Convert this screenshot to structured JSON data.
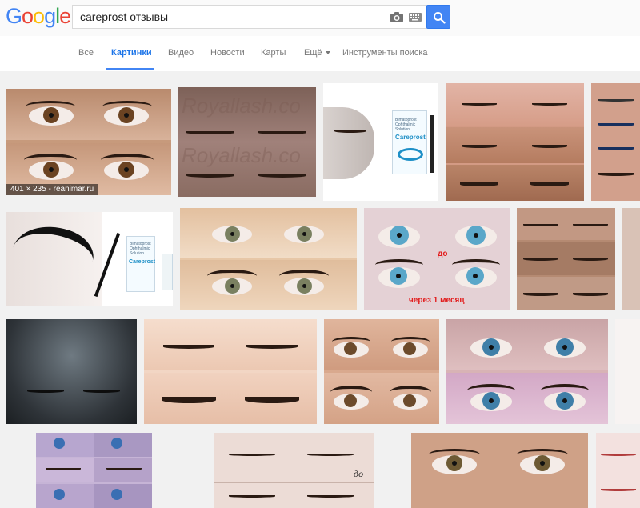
{
  "search": {
    "query": "careprost отзывы"
  },
  "logo": {
    "letters": [
      "G",
      "o",
      "o",
      "g",
      "l",
      "e"
    ],
    "colors": [
      "#4285f4",
      "#ea4335",
      "#fbbc05",
      "#4285f4",
      "#34a853",
      "#ea4335"
    ]
  },
  "tabs": {
    "all": "Все",
    "images": "Картинки",
    "video": "Видео",
    "news": "Новости",
    "maps": "Карты",
    "more": "Ещё",
    "tools": "Инструменты поиска"
  },
  "thumbs": {
    "first_caption": "401 × 235 - reanimar.ru",
    "watermark_royal": "Royallash.co",
    "careprost_brand": "Careprost",
    "careprost_sub": "Bimatoprost Ophthalmic Solution",
    "label_before": "до",
    "label_after": "через 1 месяц",
    "label_do": "до"
  },
  "colors": {
    "accent": "#4285f4",
    "active_tab": "#1a73e8",
    "header_bg": "#fafafa",
    "results_bg": "#f1f1f1"
  },
  "icons": {
    "camera": "camera-icon",
    "keyboard": "keyboard-icon",
    "search": "search-icon",
    "more_caret": "caret-down-icon"
  }
}
